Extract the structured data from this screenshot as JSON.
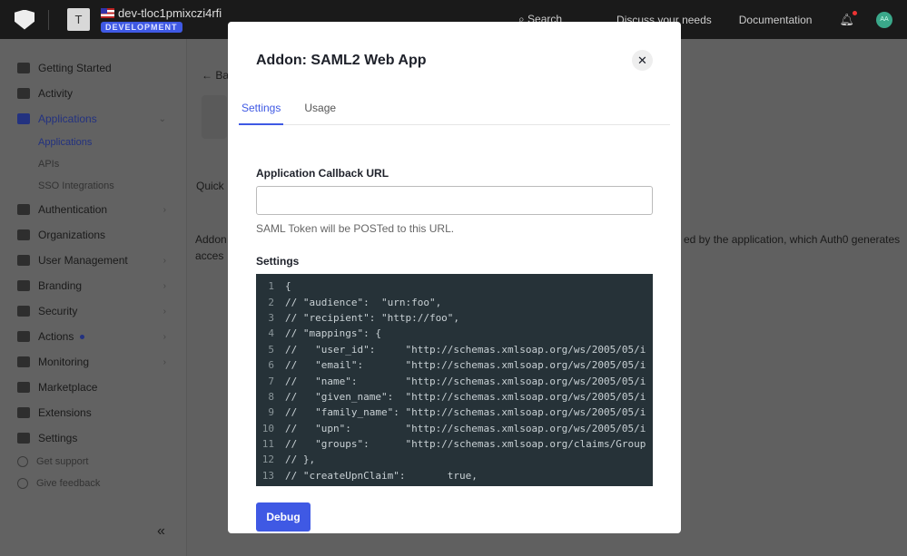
{
  "topbar": {
    "tenant_initial": "T",
    "tenant_name": "dev-tloc1pmixczi4rfi",
    "env_badge": "DEVELOPMENT",
    "search": "Search",
    "discuss": "Discuss your needs",
    "docs": "Documentation",
    "avatar": "AA"
  },
  "sidebar": {
    "items": [
      {
        "label": "Getting Started",
        "icon": "bolt-icon"
      },
      {
        "label": "Activity",
        "icon": "chart-icon"
      },
      {
        "label": "Applications",
        "icon": "layers-icon",
        "active": true
      },
      {
        "label": "Authentication",
        "icon": "lock-icon"
      },
      {
        "label": "Organizations",
        "icon": "building-icon"
      },
      {
        "label": "User Management",
        "icon": "users-icon"
      },
      {
        "label": "Branding",
        "icon": "brush-icon"
      },
      {
        "label": "Security",
        "icon": "shield-icon"
      },
      {
        "label": "Actions",
        "icon": "actions-icon"
      },
      {
        "label": "Monitoring",
        "icon": "bar-chart-icon"
      },
      {
        "label": "Marketplace",
        "icon": "plus-grid-icon"
      },
      {
        "label": "Extensions",
        "icon": "extension-icon"
      },
      {
        "label": "Settings",
        "icon": "gear-icon"
      }
    ],
    "sub_items": [
      "Applications",
      "APIs",
      "SSO Integrations"
    ],
    "footer": [
      "Get support",
      "Give feedback"
    ]
  },
  "main": {
    "back": "Ba",
    "tab_partial": "Quick",
    "desc_1": "Addon",
    "desc_1_end": "ed by the application, which Auth0 generates",
    "desc_2": "acces"
  },
  "modal": {
    "title": "Addon: SAML2 Web App",
    "tabs": [
      "Settings",
      "Usage"
    ],
    "callback_label": "Application Callback URL",
    "callback_value": "",
    "callback_help": "SAML Token will be POSTed to this URL.",
    "settings_label": "Settings",
    "debug": "Debug",
    "code": [
      "{",
      "// \"audience\":  \"urn:foo\",",
      "// \"recipient\": \"http://foo\",",
      "// \"mappings\": {",
      "//   \"user_id\":     \"http://schemas.xmlsoap.org/ws/2005/05/i",
      "//   \"email\":       \"http://schemas.xmlsoap.org/ws/2005/05/i",
      "//   \"name\":        \"http://schemas.xmlsoap.org/ws/2005/05/i",
      "//   \"given_name\":  \"http://schemas.xmlsoap.org/ws/2005/05/i",
      "//   \"family_name\": \"http://schemas.xmlsoap.org/ws/2005/05/i",
      "//   \"upn\":         \"http://schemas.xmlsoap.org/ws/2005/05/i",
      "//   \"groups\":      \"http://schemas.xmlsoap.org/claims/Group",
      "// },",
      "// \"createUpnClaim\":       true,"
    ]
  },
  "colors": {
    "accent": "#3f59e4",
    "editor_bg": "#263238"
  }
}
